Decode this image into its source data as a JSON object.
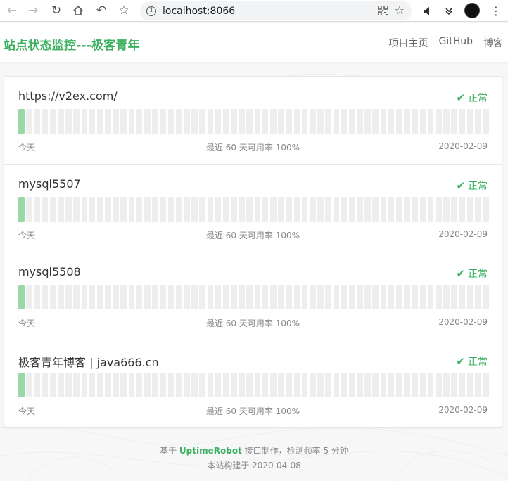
{
  "browser": {
    "url": "localhost:8066",
    "icons": [
      "back-icon",
      "forward-icon",
      "reload-icon",
      "home-icon",
      "undo-icon",
      "bookmark-star-icon",
      "info-icon",
      "qr-code-icon",
      "star-icon",
      "mute-icon",
      "chevrons-icon",
      "avatar",
      "menu-icon"
    ]
  },
  "header": {
    "title": "站点状态监控---极客青年",
    "links": [
      "项目主页",
      "GitHub",
      "博客"
    ]
  },
  "monitors": [
    {
      "name": "https://v2ex.com/",
      "status": "正常",
      "day_left": "今天",
      "uptime": "最近 60 天可用率 100%",
      "date": "2020-02-09"
    },
    {
      "name": "mysql5507",
      "status": "正常",
      "day_left": "今天",
      "uptime": "最近 60 天可用率 100%",
      "date": "2020-02-09"
    },
    {
      "name": "mysql5508",
      "status": "正常",
      "day_left": "今天",
      "uptime": "最近 60 天可用率 100%",
      "date": "2020-02-09"
    },
    {
      "name": "极客青年博客 | java666.cn",
      "status": "正常",
      "day_left": "今天",
      "uptime": "最近 60 天可用率 100%",
      "date": "2020-02-09"
    }
  ],
  "bars_per_row": 60,
  "bars_up_count": 1,
  "colors": {
    "accent": "#3bb05e",
    "bar_up": "#9ad8a8",
    "bar_empty": "#eeeeee"
  },
  "footer": {
    "line1_prefix": "基于",
    "line1_link": "UptimeRobot",
    "line1_suffix": "接口制作，检测频率 5 分钟",
    "line2": "本站构建于 2020-04-08"
  }
}
